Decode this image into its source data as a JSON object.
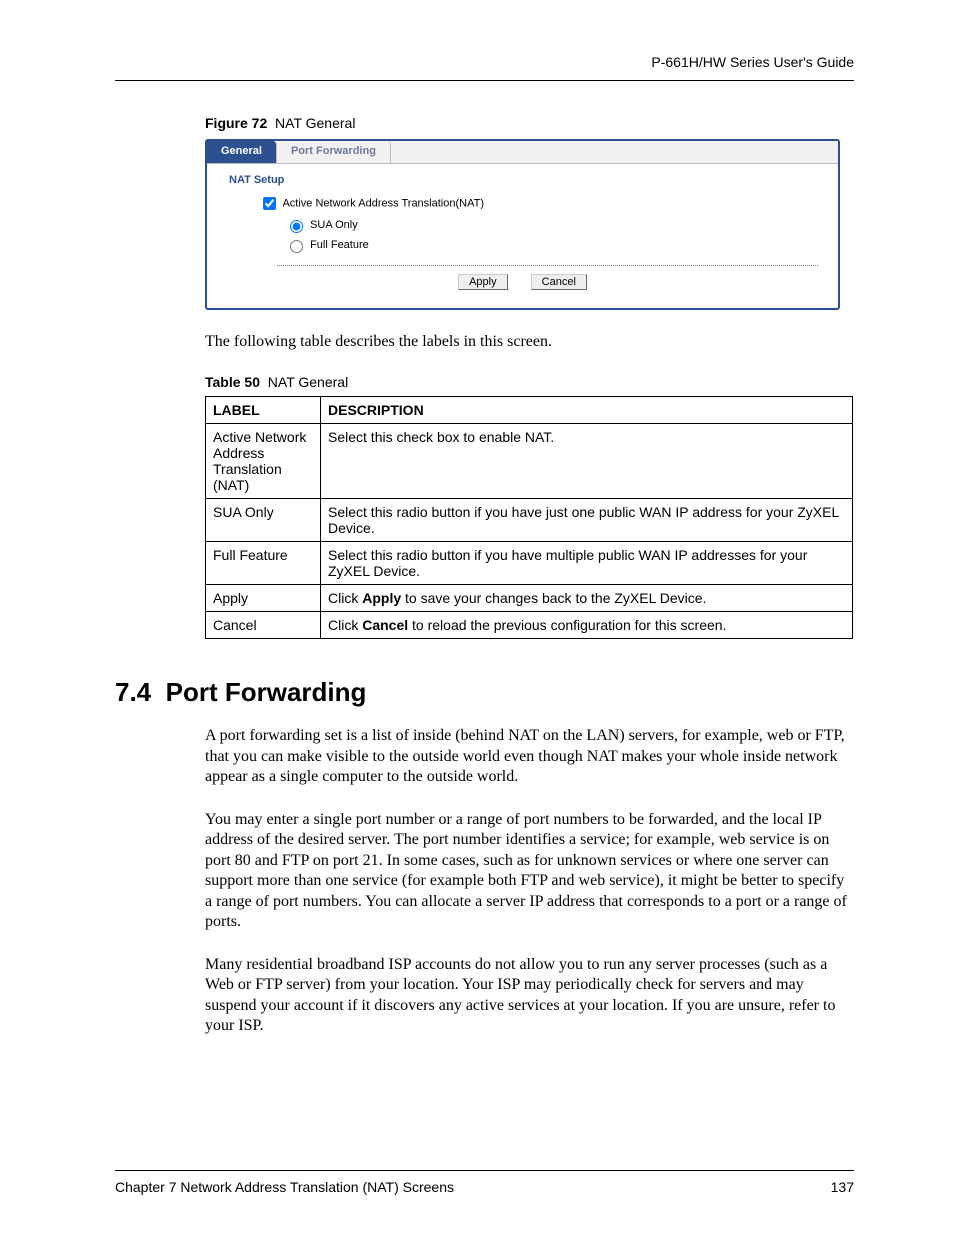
{
  "header": {
    "guide": "P-661H/HW Series User's Guide"
  },
  "figure": {
    "label": "Figure 72",
    "title": "NAT General"
  },
  "screenshot": {
    "tabs": {
      "general": "General",
      "port_forwarding": "Port Forwarding"
    },
    "panel_title": "NAT Setup",
    "checkbox": "Active Network Address Translation(NAT)",
    "radio_sua": "SUA Only",
    "radio_full": "Full Feature",
    "apply": "Apply",
    "cancel": "Cancel"
  },
  "intro_para": "The following table describes the labels in this screen.",
  "table_caption": {
    "label": "Table 50",
    "title": "NAT General"
  },
  "table": {
    "head_label": "LABEL",
    "head_desc": "DESCRIPTION",
    "rows": [
      {
        "label": "Active Network Address Translation (NAT)",
        "desc_pre": "Select this check box to enable NAT.",
        "bold": "",
        "desc_post": ""
      },
      {
        "label": "SUA Only",
        "desc_pre": "Select this radio button if you have just one public WAN IP address for your ZyXEL Device.",
        "bold": "",
        "desc_post": ""
      },
      {
        "label": "Full Feature",
        "desc_pre": "Select this radio button if you have multiple public WAN IP addresses for your ZyXEL Device.",
        "bold": "",
        "desc_post": ""
      },
      {
        "label": "Apply",
        "desc_pre": "Click ",
        "bold": "Apply",
        "desc_post": " to save your changes back to the ZyXEL Device."
      },
      {
        "label": "Cancel",
        "desc_pre": "Click ",
        "bold": "Cancel",
        "desc_post": " to reload the previous configuration for this screen."
      }
    ]
  },
  "section": {
    "num": "7.4",
    "title": "Port Forwarding"
  },
  "paras": {
    "p1": "A port forwarding set is a list of inside (behind NAT on the LAN) servers, for example, web or FTP, that you can make visible to the outside world even though NAT makes your whole inside network appear as a single computer to the outside world.",
    "p2": "You may enter a single port number or a range of port numbers to be forwarded, and the local IP address of the desired server. The port number identifies a service; for example, web service is on port 80 and FTP on port 21. In some cases, such as for unknown services or where one server can support more than one service (for example both FTP and web service), it might be better to specify a range of port numbers. You can allocate a server IP address that corresponds to a port or a range of ports.",
    "p3": "Many residential broadband ISP accounts do not allow you to run any server processes (such as a Web or FTP server) from your location. Your ISP may periodically check for servers and may suspend your account if it discovers any active services at your location. If you are unsure, refer to your ISP."
  },
  "footer": {
    "chapter": "Chapter 7 Network Address Translation (NAT) Screens",
    "page": "137"
  }
}
